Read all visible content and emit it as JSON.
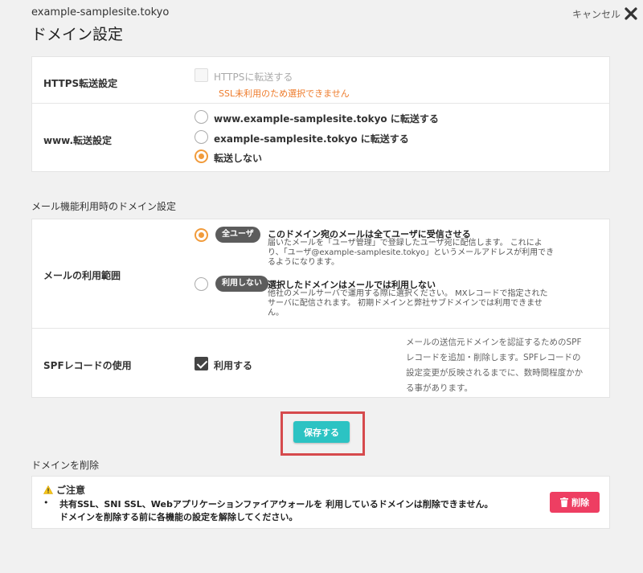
{
  "header": {
    "site_name": "example-samplesite.tokyo",
    "title": "ドメイン設定",
    "cancel_label": "キャンセル"
  },
  "redirect": {
    "https": {
      "label": "HTTPS転送設定",
      "checkbox_label": "HTTPSに転送する",
      "checked": false,
      "disabled": true,
      "warning": "SSL未利用のため選択できません"
    },
    "www": {
      "label": "www.転送設定",
      "options": [
        {
          "label": "www.example-samplesite.tokyo に転送する",
          "selected": false
        },
        {
          "label": "example-samplesite.tokyo に転送する",
          "selected": false
        },
        {
          "label": "転送しない",
          "selected": true
        }
      ]
    }
  },
  "mail_section": {
    "heading": "メール機能利用時のドメイン設定",
    "scope": {
      "label": "メールの利用範囲",
      "options": [
        {
          "badge": "全ユーザ",
          "title": "このドメイン宛のメールは全てユーザに受信させる",
          "desc1": "届いたメールを「ユーザ管理」で登録したユーザ宛に配信します。 これによ",
          "desc2": "り、「ユーザ@example-samplesite.tokyo」というメールアドレスが利用でき",
          "desc3": "るようになります。",
          "selected": true
        },
        {
          "badge": "利用しない",
          "title": "選択したドメインはメールでは利用しない",
          "desc1": "他社のメールサーバで運用する際に選択ください。 MXレコードで指定された",
          "desc2": "サーバに配信されます。 初期ドメインと弊社サブドメインでは利用できませ",
          "desc3": "ん。",
          "selected": false
        }
      ]
    },
    "spf": {
      "label": "SPFレコードの使用",
      "checkbox_label": "利用する",
      "checked": true,
      "note1": "メールの送信元ドメインを認証するためのSPF",
      "note2": "レコードを追加・削除します。SPFレコードの",
      "note3": "設定変更が反映されるまでに、数時間程度かか",
      "note4": "る事があります。"
    }
  },
  "save_label": "保存する",
  "delete_section": {
    "heading": "ドメインを削除",
    "notice_title": "ご注意",
    "notice_line1": "共有SSL、SNI SSL、Webアプリケーションファイアウォールを 利用しているドメインは削除できません。",
    "notice_line2": "ドメインを削除する前に各機能の設定を解除してください。",
    "delete_label": "削除"
  },
  "colors": {
    "accent_orange": "#f19b3b",
    "save_teal": "#2cc3c3",
    "delete_pink": "#ee3e62",
    "highlight_red": "#d64a4d"
  }
}
